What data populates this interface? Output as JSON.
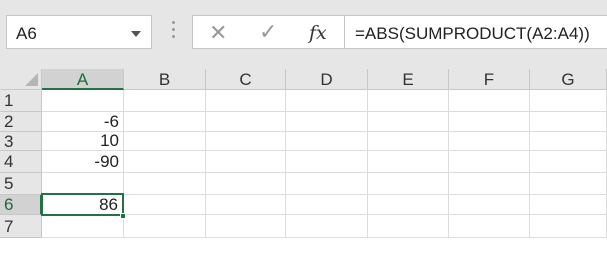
{
  "formula_bar": {
    "name_box": "A6",
    "cancel_glyph": "✕",
    "enter_glyph": "✓",
    "fx_label": "fx",
    "formula": "=ABS(SUMPRODUCT(A2:A4))"
  },
  "columns": [
    "A",
    "B",
    "C",
    "D",
    "E",
    "F",
    "G"
  ],
  "rows": [
    "1",
    "2",
    "3",
    "4",
    "5",
    "6",
    "7"
  ],
  "cells": {
    "A1": "",
    "A2": "-6",
    "A3": "10",
    "A4": "-90",
    "A5": "",
    "A6": "86",
    "A7": ""
  },
  "selection": {
    "active_cell": "A6",
    "active_column": "A",
    "active_row": "6"
  },
  "colors": {
    "accent": "#217346",
    "header_bg": "#e6e6e6",
    "gridline": "#dcdcdc"
  }
}
